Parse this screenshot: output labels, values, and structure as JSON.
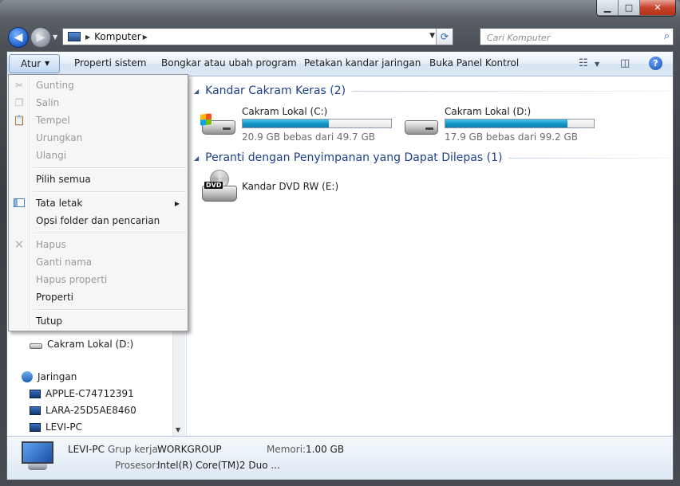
{
  "window": {
    "controls": {
      "minimize": "▁",
      "maximize": "□",
      "close": "✕"
    }
  },
  "nav": {
    "address": {
      "crumb": "Komputer"
    },
    "search": {
      "placeholder": "Cari Komputer"
    }
  },
  "toolbar": {
    "items": [
      "Atur",
      "Properti sistem",
      "Bongkar atau ubah program",
      "Petakan kandar jaringan",
      "Buka Panel Kontrol"
    ],
    "help": "?"
  },
  "context_menu": {
    "items": [
      {
        "label": "Gunting",
        "enabled": false
      },
      {
        "label": "Salin",
        "enabled": false
      },
      {
        "label": "Tempel",
        "enabled": false
      },
      {
        "label": "Urungkan",
        "enabled": false
      },
      {
        "label": "Ulangi",
        "enabled": false
      },
      {
        "label": "Pilih semua",
        "enabled": true
      },
      {
        "label": "Tata letak",
        "enabled": true
      },
      {
        "label": "Opsi folder dan pencarian",
        "enabled": true
      },
      {
        "label": "Hapus",
        "enabled": false
      },
      {
        "label": "Ganti nama",
        "enabled": false
      },
      {
        "label": "Hapus properti",
        "enabled": false
      },
      {
        "label": "Properti",
        "enabled": true
      },
      {
        "label": "Tutup",
        "enabled": true
      }
    ]
  },
  "nav_pane": {
    "drive_d": "Cakram Lokal (D:)",
    "network": "Jaringan",
    "computers": [
      "APPLE-C74712391",
      "LARA-25D5AE8460",
      "LEVI-PC"
    ]
  },
  "content": {
    "groups": [
      {
        "title": "Kandar Cakram Keras (2)"
      },
      {
        "title": "Peranti dengan Penyimpanan yang Dapat Dilepas (1)"
      }
    ],
    "drives": [
      {
        "name": "Cakram Lokal (C:)",
        "free": "20.9 GB bebas dari 49.7 GB",
        "used_fraction": 0.58
      },
      {
        "name": "Cakram Lokal (D:)",
        "free": "17.9 GB bebas dari 99.2 GB",
        "used_fraction": 0.82
      }
    ],
    "dvd": {
      "name": "Kandar DVD RW (E:)",
      "badge": "DVD"
    }
  },
  "details": {
    "computer_name": "LEVI-PC",
    "workgroup_label": "Grup kerja:",
    "workgroup": "WORKGROUP",
    "memory_label": "Memori:",
    "memory": "1.00 GB",
    "processor_label": "Prosesor:",
    "processor": "Intel(R) Core(TM)2 Duo ..."
  }
}
